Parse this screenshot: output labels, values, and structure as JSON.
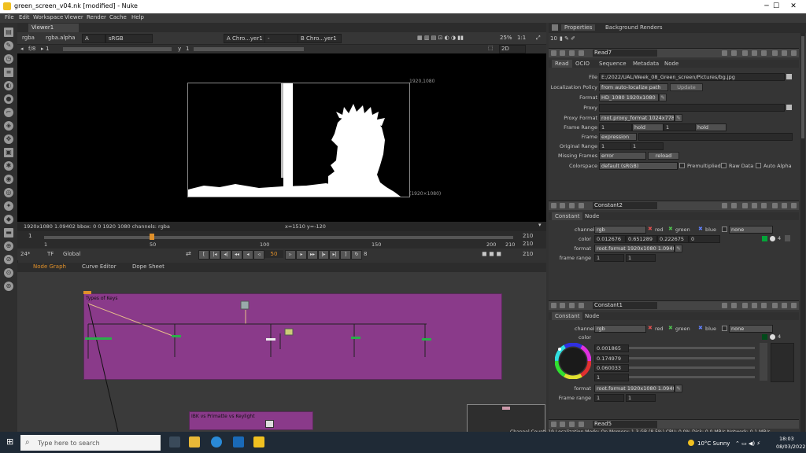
{
  "window": {
    "title": "green_screen_v04.nk [modified] - Nuke",
    "controls": {
      "minimize": "─",
      "maximize": "☐",
      "close": "✕"
    }
  },
  "menu": [
    "File",
    "Edit",
    "Workspace",
    "Viewer",
    "Render",
    "Cache",
    "Help"
  ],
  "viewer": {
    "tab": "Viewer1",
    "channels": "rgba",
    "channel_display": "rgba.alpha",
    "a_layer": "A",
    "colorspace": "sRGB",
    "input_a": "A  Chro...yer1",
    "blend_mode": "-",
    "input_b": "B  Chro...yer1",
    "zoom": "25%",
    "ratio": "1:1",
    "view_mode": "2D",
    "fstop": "f/8",
    "frame_field": "1",
    "y_label": "y",
    "y_value": "1",
    "res_top": "1920,1080",
    "res_bottom": "(1920×1080)",
    "info": "1920x1080 1.09402   bbox: 0 0 1920 1080 channels: rgba",
    "coords": "x=1510 y=-120"
  },
  "timeline": {
    "start": "1",
    "end": "210",
    "end_right": "210",
    "ticks": [
      "1",
      "50",
      "100",
      "150",
      "200",
      "210"
    ],
    "current": "50",
    "fps": "24*",
    "tf": "TF",
    "global": "Global",
    "inc": "8",
    "marker_label": "210",
    "marker_label_2": "210"
  },
  "nodegraph": {
    "tabs": [
      "Node Graph",
      "Curve Editor",
      "Dope Sheet"
    ],
    "backdrop1": "Types of Keys",
    "backdrop2": "IBK vs Primatte vs Keylight"
  },
  "properties": {
    "tabs": [
      "Properties",
      "Background Renders"
    ],
    "count": "10",
    "read7": {
      "name": "Read7",
      "tabs": [
        "Read",
        "OCIO",
        "Sequence",
        "Metadata",
        "Node"
      ],
      "file_label": "File",
      "file": "E:/2022/UAL/Week_08_Green_screen/Pictures/bg.jpg",
      "localization_label": "Localization Policy",
      "localization": "from auto-localize path",
      "update": "Update",
      "format_label": "Format",
      "format": "HD_1080 1920x1080",
      "proxy_label": "Proxy",
      "proxy_format_label": "Proxy Format",
      "proxy_format": "root.proxy_format 1024x778",
      "frame_range_label": "Frame Range",
      "fr_start": "1",
      "fr_before": "hold",
      "fr_end": "1",
      "fr_after": "hold",
      "frame_label": "Frame",
      "frame": "expression",
      "orig_range_label": "Original Range",
      "orig_start": "1",
      "orig_end": "1",
      "missing_label": "Missing Frames",
      "missing": "error",
      "reload": "reload",
      "colorspace_label": "Colorspace",
      "colorspace": "default (sRGB)",
      "premult": "Premultiplied",
      "raw": "Raw Data",
      "auto_alpha": "Auto Alpha"
    },
    "constant2": {
      "name": "Constant2",
      "tabs": [
        "Constant",
        "Node"
      ],
      "channels_label": "channels",
      "channels": "rgb",
      "red": "red",
      "green": "green",
      "blue": "blue",
      "none": "none",
      "color_label": "color",
      "r": "0.012676",
      "g": "0.651289",
      "b": "0.222675",
      "a": "0",
      "count": "4",
      "format_label": "format",
      "format": "root.format 1920x1080 1.09402",
      "frame_range_label": "frame range",
      "fr_start": "1",
      "fr_end": "1"
    },
    "constant1": {
      "name": "Constant1",
      "tabs": [
        "Constant",
        "Node"
      ],
      "channels_label": "channels",
      "channels": "rgb",
      "red": "red",
      "green": "green",
      "blue": "blue",
      "none": "none",
      "color_label": "color",
      "r": "0.001865",
      "g": "0.174979",
      "b": "0.060033",
      "a": "1",
      "count": "4",
      "format_label": "format",
      "format": "root.format 1920x1080 1.09402",
      "frame_range_label": "Frame range",
      "fr_start": "1",
      "fr_end": "1"
    },
    "read5": {
      "name": "Read5"
    }
  },
  "status": "Channel Count: 19  Localization Mode: On  Memory: 1.3 GB (8.5%)  CPU: 0.0%  Disk: 0.0 MB/s  Network: 0.1 MB/s",
  "taskbar": {
    "search_placeholder": "Type here to search",
    "weather": "10°C  Sunny",
    "time": "18:03",
    "date": "08/03/2022"
  },
  "colors": {
    "backdrop": "#8a3a8a",
    "accent_orange": "#e0902a",
    "green_swatch": "#03a639"
  }
}
